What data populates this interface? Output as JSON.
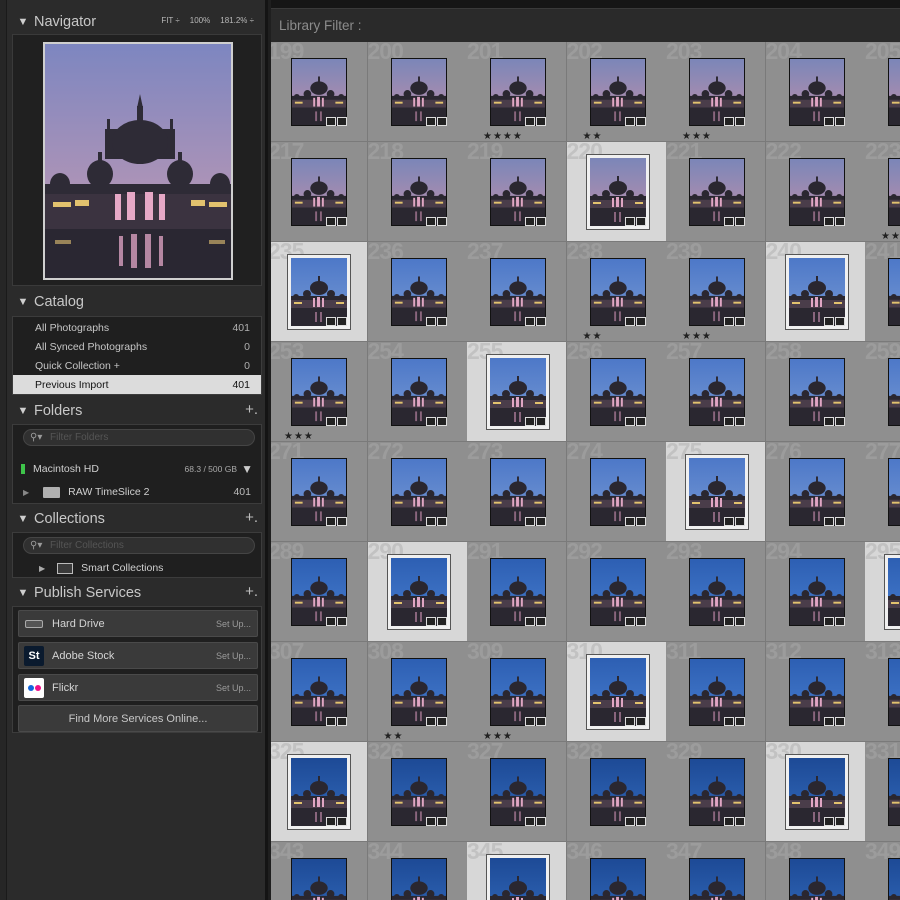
{
  "navigator": {
    "title": "Navigator",
    "opt_fit": "FIT ÷",
    "opt_100": "100%",
    "opt_zoom": "181.2% ÷"
  },
  "catalog": {
    "title": "Catalog",
    "rows": [
      {
        "label": "All Photographs",
        "count": "401"
      },
      {
        "label": "All Synced Photographs",
        "count": "0"
      },
      {
        "label": "Quick Collection  +",
        "count": "0"
      },
      {
        "label": "Previous Import",
        "count": "401"
      }
    ]
  },
  "folders": {
    "title": "Folders",
    "plus": "+.",
    "filter_placeholder": "Filter Folders",
    "volume": {
      "name": "Macintosh HD",
      "usage": "68.3 / 500 GB"
    },
    "folder": {
      "name": "RAW TimeSlice 2",
      "count": "401"
    }
  },
  "collections": {
    "title": "Collections",
    "plus": "+.",
    "filter_placeholder": "Filter Collections",
    "item": "Smart Collections"
  },
  "publish": {
    "title": "Publish Services",
    "plus": "+.",
    "services": [
      {
        "name": "Hard Drive",
        "setup": "Set Up...",
        "icon": "hard-drive-icon"
      },
      {
        "name": "Adobe Stock",
        "setup": "Set Up...",
        "icon": "adobe-stock-icon",
        "glyph": "St"
      },
      {
        "name": "Flickr",
        "setup": "Set Up...",
        "icon": "flickr-icon"
      }
    ],
    "find_more": "Find More Services Online..."
  },
  "library_filter": {
    "label": "Library Filter :"
  },
  "grid": {
    "rows": [
      {
        "nums": [
          "199",
          "200",
          "201",
          "202",
          "203",
          "204",
          "205"
        ],
        "sky": 1
      },
      {
        "nums": [
          "217",
          "218",
          "219",
          "220",
          "221",
          "222",
          "223"
        ],
        "sky": 1
      },
      {
        "nums": [
          "235",
          "236",
          "237",
          "238",
          "239",
          "240",
          "241"
        ],
        "sky": 2
      },
      {
        "nums": [
          "253",
          "254",
          "255",
          "256",
          "257",
          "258",
          "259"
        ],
        "sky": 2
      },
      {
        "nums": [
          "271",
          "272",
          "273",
          "274",
          "275",
          "276",
          "277"
        ],
        "sky": 2
      },
      {
        "nums": [
          "289",
          "290",
          "291",
          "292",
          "293",
          "294",
          "295"
        ],
        "sky": 3
      },
      {
        "nums": [
          "307",
          "308",
          "309",
          "310",
          "311",
          "312",
          "313"
        ],
        "sky": 3
      },
      {
        "nums": [
          "325",
          "326",
          "327",
          "328",
          "329",
          "330",
          "331"
        ],
        "sky": 4
      },
      {
        "nums": [
          "343",
          "344",
          "345",
          "346",
          "347",
          "348",
          "349"
        ],
        "sky": 4
      }
    ],
    "selected": [
      "220",
      "235",
      "240",
      "255",
      "275",
      "290",
      "295",
      "310",
      "325",
      "330",
      "345"
    ],
    "stars": {
      "201": "★★★★",
      "202": "★★",
      "203": "★★★",
      "223": "★★",
      "238": "★★",
      "239": "★★★",
      "253": "★★★",
      "308": "★★",
      "309": "★★★"
    }
  }
}
